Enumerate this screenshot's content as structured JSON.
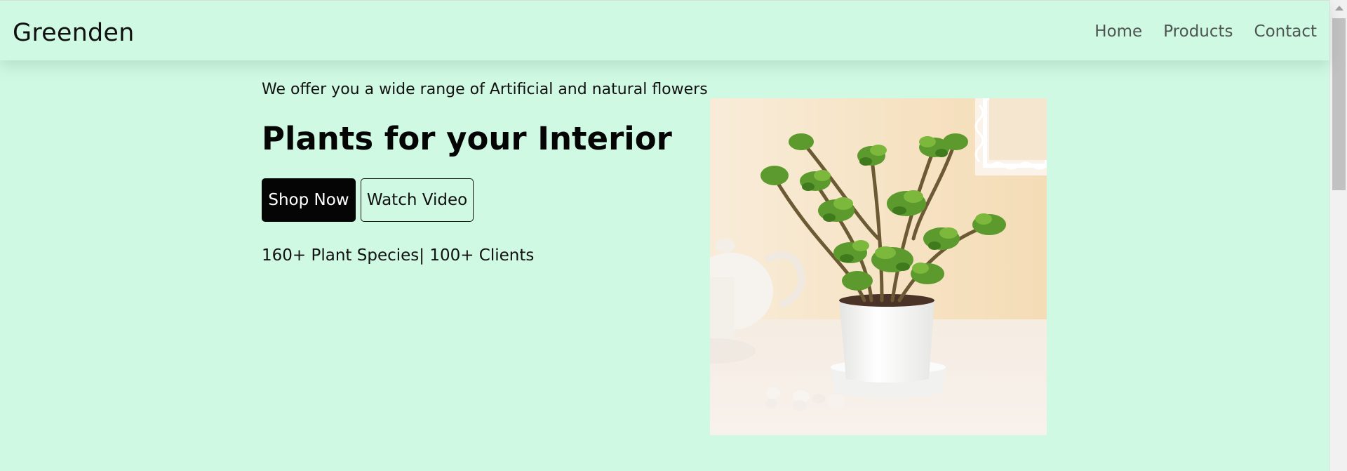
{
  "navbar": {
    "brand": "Greenden",
    "links": [
      {
        "label": "Home"
      },
      {
        "label": "Products"
      },
      {
        "label": "Contact"
      }
    ]
  },
  "hero": {
    "tagline": "We offer you a wide range of Artificial and natural flowers",
    "headline": "Plants for your Interior",
    "primary_button": "Shop Now",
    "secondary_button": "Watch Video",
    "stats": "160+ Plant Species| 100+ Clients",
    "image_icon": "potted-plant-photo"
  },
  "colors": {
    "background": "#cff9e3",
    "primary_button_bg": "#050505",
    "primary_button_text": "#ffffff",
    "nav_link": "#4e5551"
  }
}
